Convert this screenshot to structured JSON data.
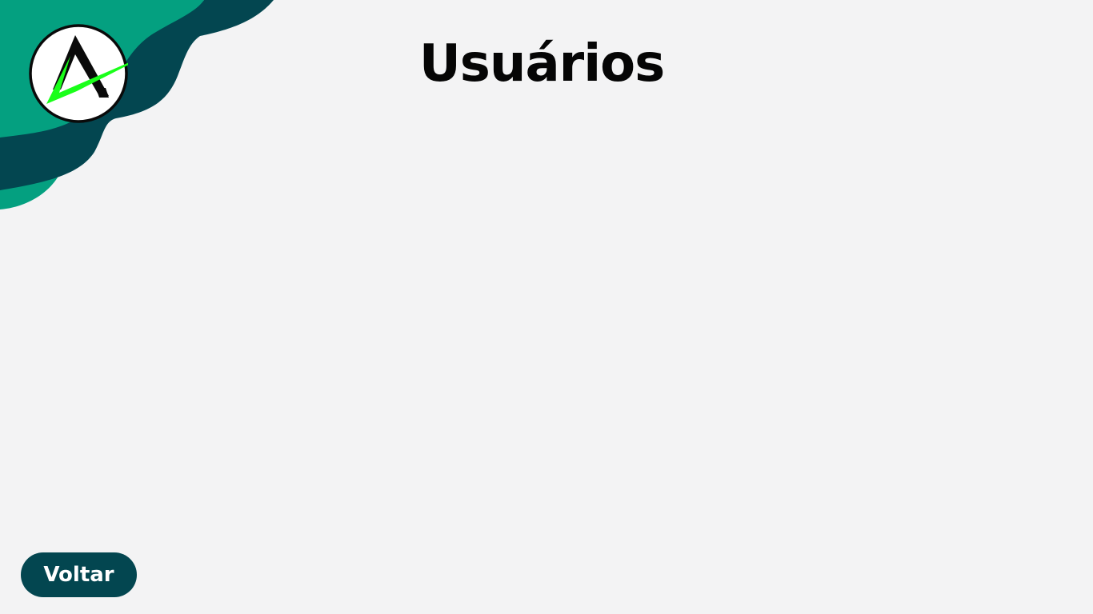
{
  "page": {
    "title": "Usuários"
  },
  "actions": {
    "back_label": "Voltar"
  },
  "theme": {
    "background": "#f3f3f4",
    "wave_light": "#04a080",
    "wave_dark": "#034650",
    "logo_accent": "#1aff1a",
    "button_bg": "#034650",
    "button_text": "#ffffff",
    "title_color": "#050505"
  },
  "icons": {
    "logo": "app-logo-icon"
  }
}
